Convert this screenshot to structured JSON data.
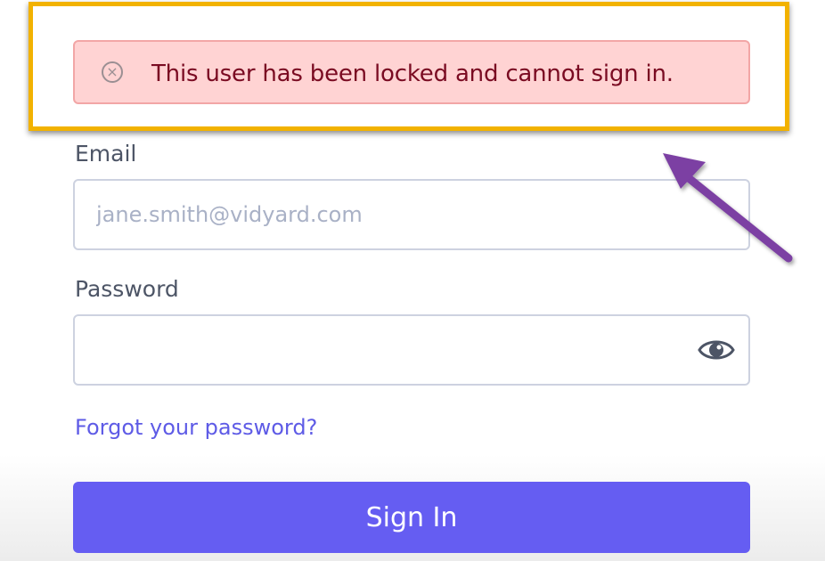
{
  "alert": {
    "message": "This user has been locked and cannot sign in.",
    "icon": "error-circle-x-icon",
    "icon_glyph": "×",
    "background_color": "#ffd3d3",
    "border_color": "#f2a6a6",
    "text_color": "#7a0b22"
  },
  "annotation": {
    "highlight_color": "#f2b200",
    "arrow_color": "#7b3fa3",
    "arrow_icon": "pointer-arrow-icon"
  },
  "form": {
    "email": {
      "label": "Email",
      "placeholder": "jane.smith@vidyard.com",
      "value": ""
    },
    "password": {
      "label": "Password",
      "placeholder": "",
      "value": "",
      "toggle_icon": "eye-icon"
    },
    "forgot_password_link": "Forgot your password?",
    "submit_label": "Sign In",
    "accent_color": "#655df2",
    "link_color": "#5e5be6"
  }
}
